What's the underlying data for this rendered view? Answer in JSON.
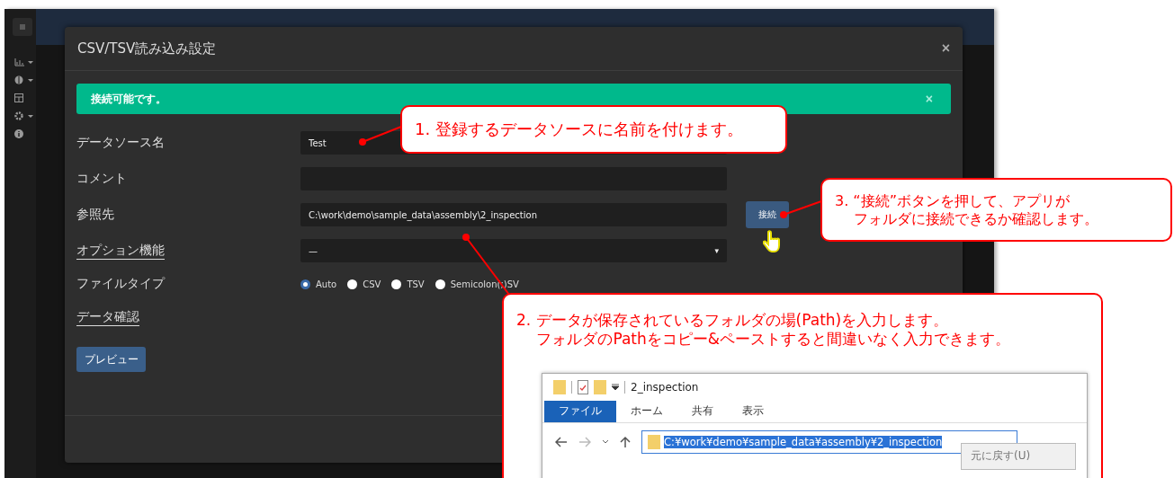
{
  "dialog": {
    "title": "CSV/TSV読み込み設定",
    "close": "×",
    "alert": {
      "text": "接続可能です。",
      "close": "×"
    },
    "fields": [
      {
        "kind": "text",
        "label": "データソース名",
        "underlined": false,
        "value": "Test"
      },
      {
        "kind": "text",
        "label": "コメント",
        "underlined": false
      },
      {
        "kind": "path",
        "label": "参照先",
        "underlined": false,
        "value": "C:\\work\\demo\\sample_data\\assembly\\2_inspection",
        "button": "接続"
      },
      {
        "kind": "select",
        "label": "オプション機能",
        "underlined": true,
        "value": "—",
        "caret": "▾"
      },
      {
        "kind": "radio",
        "label": "ファイルタイプ",
        "underlined": false,
        "options": [
          {
            "label": "Auto",
            "selected": true
          },
          {
            "label": "CSV",
            "selected": false
          },
          {
            "label": "TSV",
            "selected": false
          },
          {
            "label": "Semicolon(;)SV",
            "selected": false
          }
        ]
      }
    ],
    "section": "データ確認",
    "preview_button": "プレビュー"
  },
  "callouts": [
    {
      "lines": [
        "1. 登録するデータソースに名前を付けます。"
      ]
    },
    {
      "lines": [
        "3. “接続”ボタンを押して、アプリが",
        "　 フォルダに接続できるか確認します。"
      ]
    },
    {
      "lines": [
        "2. データが保存されているフォルダの場(Path)を入力します。",
        "　 フォルダのPathをコピー&ペーストすると間違いなく入力できます。"
      ],
      "explorer": {
        "title": "2_inspection",
        "tabs": [
          {
            "label": "ファイル",
            "selected": true
          },
          {
            "label": "ホーム",
            "selected": false
          },
          {
            "label": "共有",
            "selected": false
          },
          {
            "label": "表示",
            "selected": false
          }
        ],
        "address": "C:¥work¥demo¥sample_data¥assembly¥2_inspection",
        "menu_item": "元に戻す(U)"
      }
    }
  ]
}
